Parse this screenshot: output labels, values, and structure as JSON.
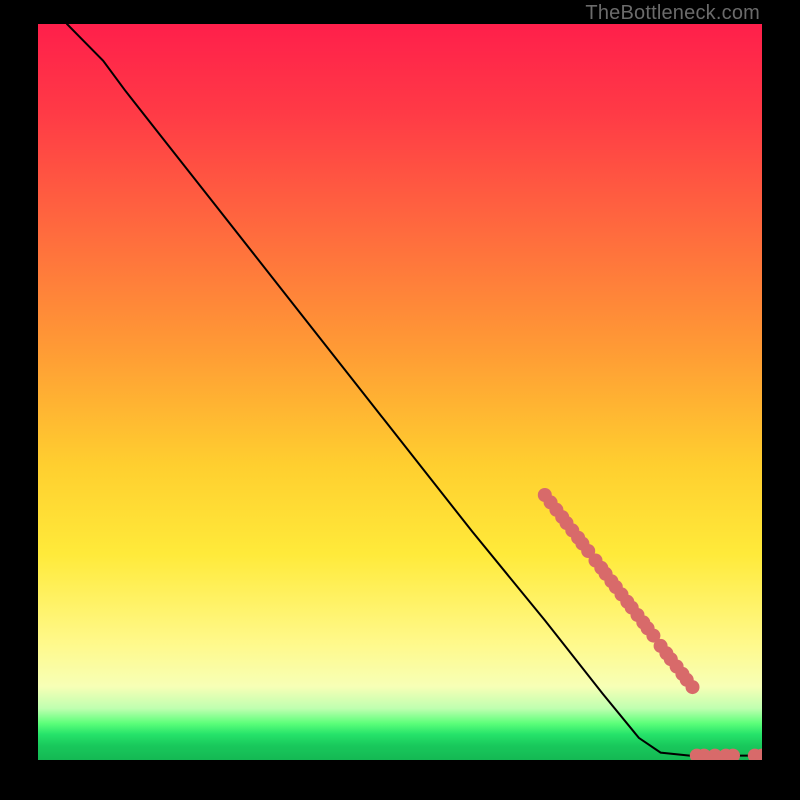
{
  "watermark": "TheBottleneck.com",
  "chart_data": {
    "type": "line",
    "title": "",
    "xlabel": "",
    "ylabel": "",
    "xlim": [
      0,
      100
    ],
    "ylim": [
      0,
      100
    ],
    "curve": [
      {
        "x": 4,
        "y": 100
      },
      {
        "x": 6,
        "y": 98
      },
      {
        "x": 9,
        "y": 95
      },
      {
        "x": 12,
        "y": 91
      },
      {
        "x": 16,
        "y": 86
      },
      {
        "x": 24,
        "y": 76
      },
      {
        "x": 36,
        "y": 61
      },
      {
        "x": 48,
        "y": 46
      },
      {
        "x": 60,
        "y": 31
      },
      {
        "x": 70,
        "y": 19
      },
      {
        "x": 78,
        "y": 9
      },
      {
        "x": 83,
        "y": 3
      },
      {
        "x": 86,
        "y": 1
      },
      {
        "x": 90,
        "y": 0.6
      },
      {
        "x": 100,
        "y": 0.6
      }
    ],
    "markers": [
      {
        "x": 70.0,
        "y": 36.0
      },
      {
        "x": 70.8,
        "y": 35.0
      },
      {
        "x": 71.6,
        "y": 34.0
      },
      {
        "x": 72.4,
        "y": 33.0
      },
      {
        "x": 73.0,
        "y": 32.2
      },
      {
        "x": 73.8,
        "y": 31.2
      },
      {
        "x": 74.6,
        "y": 30.2
      },
      {
        "x": 75.2,
        "y": 29.4
      },
      {
        "x": 76.0,
        "y": 28.4
      },
      {
        "x": 77.0,
        "y": 27.1
      },
      {
        "x": 77.8,
        "y": 26.1
      },
      {
        "x": 78.4,
        "y": 25.3
      },
      {
        "x": 79.2,
        "y": 24.3
      },
      {
        "x": 79.8,
        "y": 23.5
      },
      {
        "x": 80.6,
        "y": 22.5
      },
      {
        "x": 81.4,
        "y": 21.5
      },
      {
        "x": 82.0,
        "y": 20.7
      },
      {
        "x": 82.8,
        "y": 19.7
      },
      {
        "x": 83.6,
        "y": 18.7
      },
      {
        "x": 84.2,
        "y": 17.9
      },
      {
        "x": 85.0,
        "y": 16.9
      },
      {
        "x": 86.0,
        "y": 15.5
      },
      {
        "x": 86.8,
        "y": 14.5
      },
      {
        "x": 87.4,
        "y": 13.7
      },
      {
        "x": 88.2,
        "y": 12.7
      },
      {
        "x": 89.0,
        "y": 11.7
      },
      {
        "x": 89.6,
        "y": 10.9
      },
      {
        "x": 90.4,
        "y": 9.9
      },
      {
        "x": 91.0,
        "y": 0.6
      },
      {
        "x": 92.0,
        "y": 0.6
      },
      {
        "x": 93.5,
        "y": 0.6
      },
      {
        "x": 95.0,
        "y": 0.6
      },
      {
        "x": 96.0,
        "y": 0.6
      },
      {
        "x": 99.0,
        "y": 0.6
      },
      {
        "x": 100.0,
        "y": 0.6
      }
    ],
    "marker_radius_px": 7
  }
}
